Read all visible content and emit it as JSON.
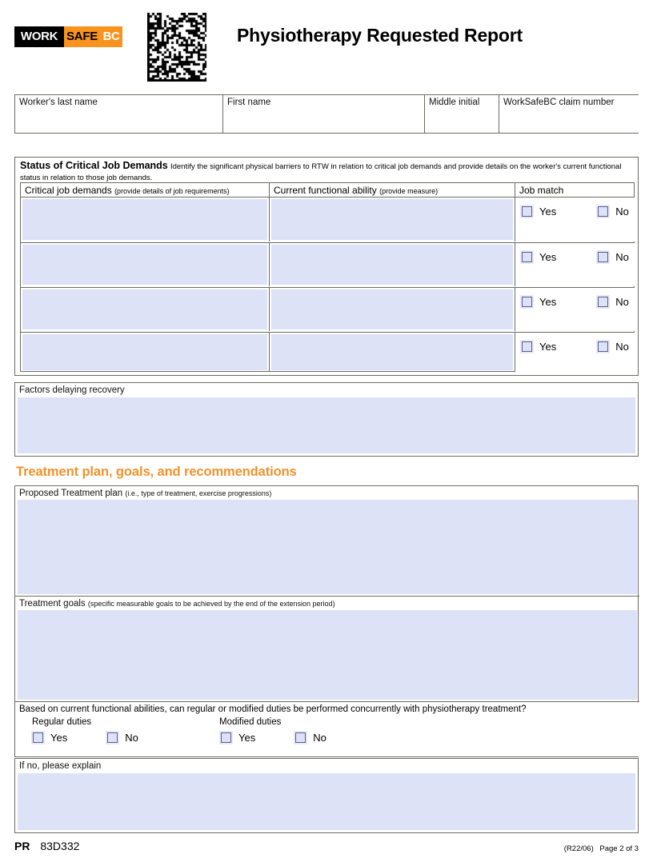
{
  "header": {
    "logo": {
      "work": "WORK",
      "safe": "SAFE",
      "bc": "BC"
    },
    "title": "Physiotherapy Requested Report",
    "barcode_alt": "datamatrix-barcode"
  },
  "name_table": {
    "cells": [
      {
        "label": "Worker's last name",
        "value": ""
      },
      {
        "label": "First name",
        "value": ""
      },
      {
        "label": "Middle initial",
        "value": ""
      },
      {
        "label": "WorkSafeBC claim number",
        "value": ""
      }
    ]
  },
  "status_section": {
    "heading": "Status of Critical Job Demands",
    "instructions": "Identify the significant physical barriers to RTW in relation to critical job demands and provide details on the worker's current functional status in relation to those job demands.",
    "columns": [
      {
        "label": "Critical job demands",
        "hint": "(provide details of job requirements)"
      },
      {
        "label": "Current functional ability",
        "hint": "(provide measure)"
      },
      {
        "label": "Job match",
        "hint": ""
      }
    ],
    "yes_label": "Yes",
    "no_label": "No",
    "rows": [
      {
        "critical_job_demand": "",
        "current_functional_ability": "",
        "job_match": ""
      },
      {
        "critical_job_demand": "",
        "current_functional_ability": "",
        "job_match": ""
      },
      {
        "critical_job_demand": "",
        "current_functional_ability": "",
        "job_match": ""
      },
      {
        "critical_job_demand": "",
        "current_functional_ability": "",
        "job_match": ""
      }
    ]
  },
  "factors_section": {
    "label": "Factors delaying recovery",
    "value": ""
  },
  "treatment_section": {
    "heading": "Treatment plan, goals, and recommendations",
    "plan": {
      "label": "Proposed Treatment plan",
      "hint": "(i.e., type of treatment, exercise progressions)",
      "value": ""
    },
    "goals": {
      "label": "Treatment goals",
      "hint": "(specific measurable goals to be achieved by the end of the extension period)",
      "value": ""
    },
    "duties": {
      "question": "Based on current functional abilities, can regular or modified duties be performed concurrently with physiotherapy treatment?",
      "regular_label": "Regular duties",
      "modified_label": "Modified duties",
      "yes_label": "Yes",
      "no_label": "No"
    },
    "if_no": {
      "label": "If no, please explain",
      "value": ""
    }
  },
  "footer": {
    "form_prefix": "PR",
    "form_code": "83D332",
    "revision": "(R22/06)",
    "page": "Page 2 of 3"
  },
  "colors": {
    "brand_orange": "#F7931E",
    "heading_orange": "#F0922B",
    "field_fill": "#DDE2F7",
    "border": "#6B6B63"
  }
}
